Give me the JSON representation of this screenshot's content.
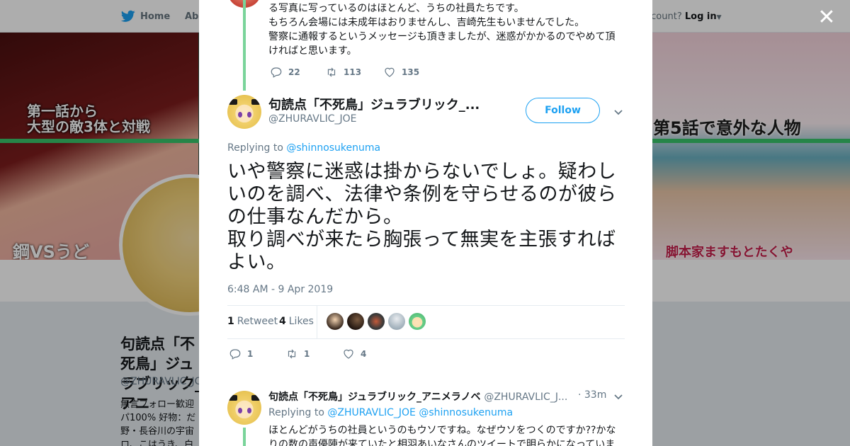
{
  "topnav": {
    "home_label": "Home",
    "about_label": "Abo",
    "account_prefix": "ccount?",
    "login_label": "Log in"
  },
  "banner": {
    "left_text_line1": "第一話から",
    "left_text_line2": "大型の敵3体と対戦",
    "left_text_bottom": "鋼VSうど",
    "right_text": "第5話で意外な人物",
    "right_text_bottom": "脚本家ますもとたくや"
  },
  "profile": {
    "name": "句読点「不死鳥」ジュラブリック_アニ",
    "handle": "@ZHURAVLIC_JOE",
    "bio": "無言フォロー歓迎 パ100% 好物：だ 野・長谷川の宇宙 ロ、こはうき、白"
  },
  "modal": {
    "prev_tweet": {
      "lines": [
        "る写真に写っているのはほとんど、うちの社員たちです。",
        "もちろん会場には未成年はおりませんし、吉崎先生もいませんでした。",
        "警察に通報するというメッセージも頂きましたが、迷惑がかかるのでやめて頂",
        "ければと思います。"
      ],
      "replies": "22",
      "retweets": "113",
      "likes": "135"
    },
    "main_tweet": {
      "author_name": "句読点「不死鳥」ジュラブリック_...",
      "author_handle": "@ZHURAVLIC_JOE",
      "follow_label": "Follow",
      "replying_prefix": "Replying to",
      "replying_to": "@shinnosukenuma",
      "text_lines": [
        "いや警察に迷惑は掛からないでしょ。疑わし",
        "いのを調べ、法律や条例を守らせるのが彼ら",
        "の仕事なんだから。",
        "取り調べが来たら胸張って無実を主張すれば",
        "よい。"
      ],
      "timestamp": "6:48 AM - 9 Apr 2019",
      "retweet_count": "1",
      "retweet_label": "Retweet",
      "like_count": "4",
      "like_label": "Likes",
      "replies": "1",
      "retweets": "1",
      "likes": "4"
    },
    "reply_tweet": {
      "author_name": "句読点「不死鳥」ジュラブリック_アニメラノベ",
      "author_handle": "@ZHURAVLIC_J...",
      "time": "· 33m",
      "replying_prefix": "Replying to",
      "replying_to_1": "@ZHURAVLIC_JOE",
      "replying_to_2": "@shinnosukenuma",
      "lines": [
        "ほとんどがうちの社員というのもウソですね。なぜウソをつくのですか??かな",
        "りの数の声優陣が来ていたと相羽あいなさんのツイートで明らかになっていま"
      ]
    }
  },
  "colors": {
    "accent": "#1da1f2",
    "thread": "#7ad49a",
    "muted": "#657786",
    "text": "#14171a"
  },
  "icons": [
    "twitter-bird-icon",
    "close-icon",
    "reply-icon",
    "retweet-icon",
    "heart-icon",
    "chevron-down-icon"
  ]
}
